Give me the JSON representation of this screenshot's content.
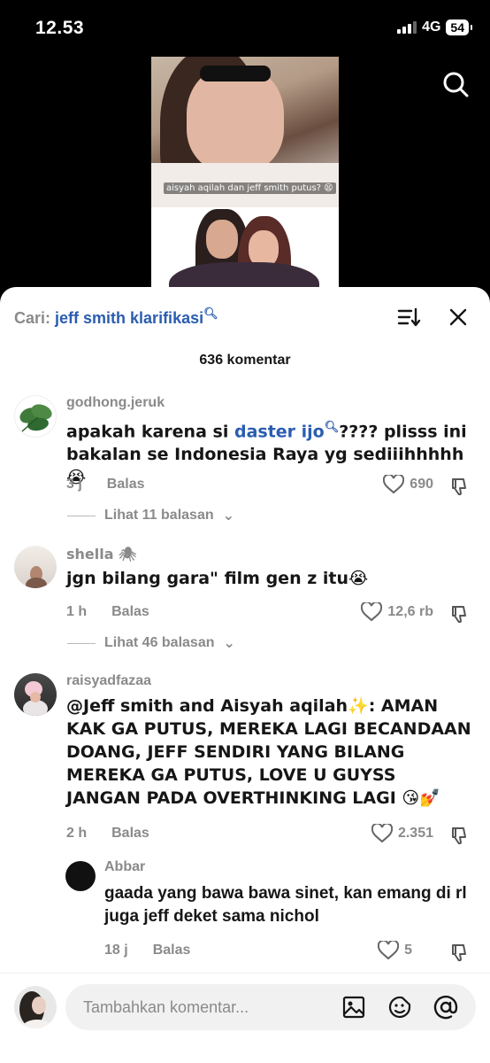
{
  "status_bar": {
    "time": "12.53",
    "network": "4G",
    "battery": "54"
  },
  "video": {
    "caption": "aisyah aqilah dan jeff smith putus? 😫"
  },
  "sheet": {
    "search_prefix": "Cari:",
    "search_query": "jeff smith klarifikasi",
    "comment_count": "636 komentar"
  },
  "comments": [
    {
      "username": "godhong.jeruk",
      "text_before": "apakah karena si ",
      "link": "daster ijo",
      "text_after": "???? plisss ini bakalan se Indonesia Raya yg sediiihhhhh😭",
      "time": "3 j",
      "reply_label": "Balas",
      "likes": "690",
      "view_replies": "Lihat 11 balasan"
    },
    {
      "username": "shella 🕷",
      "text": "jgn bilang gara\" film gen z itu😭",
      "time": "1 h",
      "reply_label": "Balas",
      "likes": "12,6 rb",
      "view_replies": "Lihat 46 balasan"
    },
    {
      "username": "raisyadfazaa",
      "text": "@Jeff smith and Aisyah aqilah✨: AMAN KAK GA PUTUS, MEREKA LAGI BECANDAAN DOANG, JEFF SENDIRI YANG BILANG MEREKA GA PUTUS, LOVE U GUYSS JANGAN PADA OVERTHINKING LAGI 😘💅",
      "time": "2 h",
      "reply_label": "Balas",
      "likes": "2.351"
    },
    {
      "username": "Abbar",
      "text": "gaada yang bawa bawa sinet, kan emang di rl juga jeff deket sama nichol",
      "time": "18 j",
      "reply_label": "Balas",
      "likes": "5"
    }
  ],
  "composer": {
    "placeholder": "Tambahkan komentar..."
  },
  "colors": {
    "link": "#2a5db0",
    "muted": "#8a8a8a",
    "text": "#161616"
  }
}
